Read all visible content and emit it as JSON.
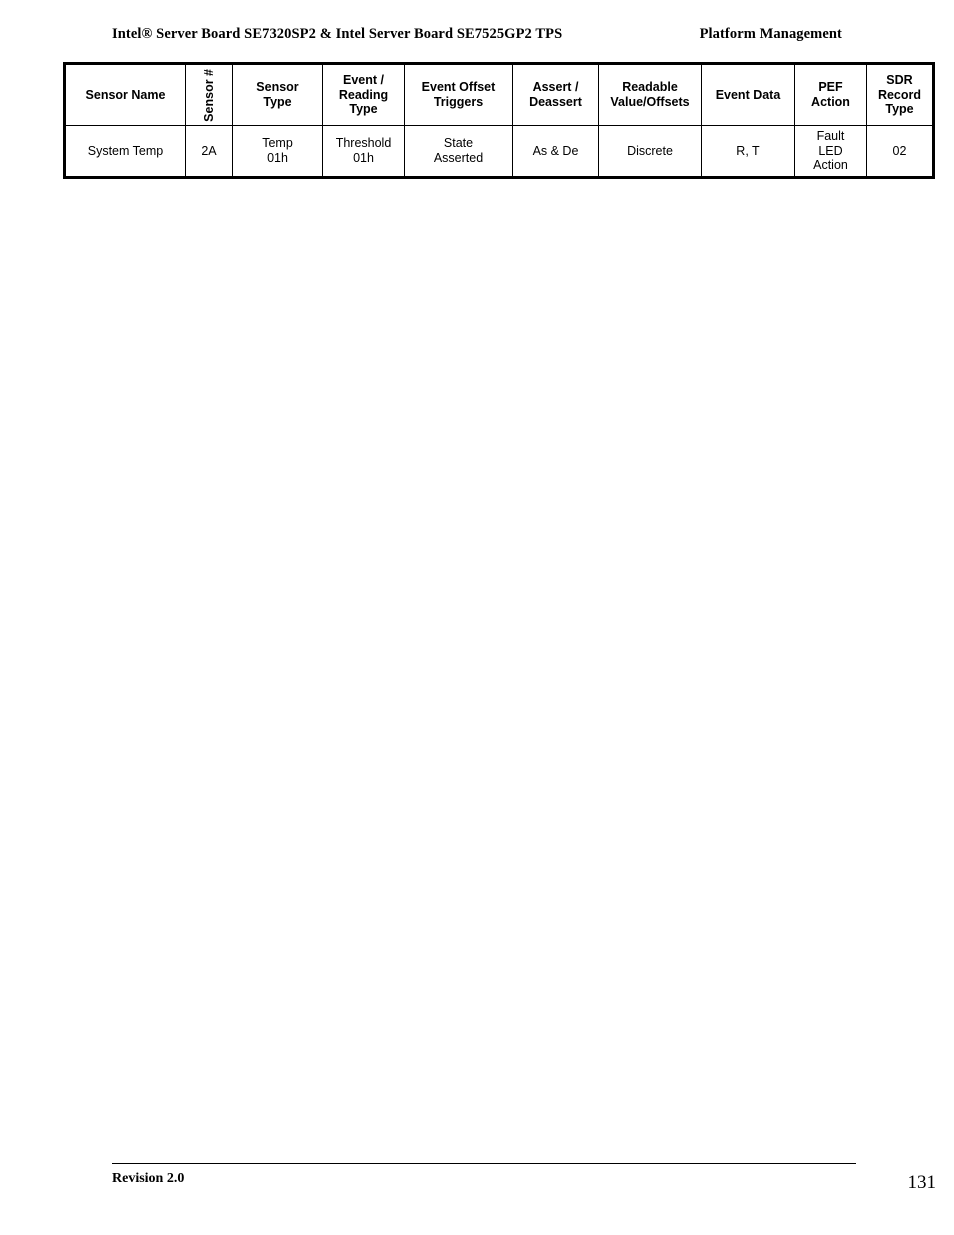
{
  "header": {
    "left_title": "Intel® Server Board SE7320SP2 & Intel Server Board SE7525GP2 TPS",
    "right_title": "Platform Management"
  },
  "table": {
    "columns": [
      {
        "label": "Sensor Name",
        "orientation": "horizontal"
      },
      {
        "label": "Sensor #",
        "orientation": "vertical"
      },
      {
        "label_line1": "Sensor",
        "label_line2": "Type",
        "orientation": "horizontal"
      },
      {
        "label_line1": "Event /",
        "label_line2": "Reading",
        "label_line3": "Type",
        "orientation": "horizontal"
      },
      {
        "label_line1": "Event Offset",
        "label_line2": "Triggers",
        "orientation": "horizontal"
      },
      {
        "label_line1": "Assert /",
        "label_line2": "Deassert",
        "orientation": "horizontal"
      },
      {
        "label_line1": "Readable",
        "label_line2": "Value/Offsets",
        "orientation": "horizontal"
      },
      {
        "label": "Event Data",
        "orientation": "horizontal"
      },
      {
        "label_line1": "PEF",
        "label_line2": "Action",
        "orientation": "horizontal"
      },
      {
        "label_line1": "SDR",
        "label_line2": "Record",
        "label_line3": "Type",
        "orientation": "horizontal"
      }
    ],
    "rows": [
      {
        "sensor_name": "System Temp",
        "sensor_number": "2A",
        "sensor_type_line1": "Temp",
        "sensor_type_line2": "01h",
        "event_reading_type_line1": "Threshold",
        "event_reading_type_line2": "01h",
        "event_offset_triggers_line1": "State",
        "event_offset_triggers_line2": "Asserted",
        "assert_deassert": "As & De",
        "readable_value_offsets": "Discrete",
        "event_data": "R, T",
        "pef_action_line1": "Fault",
        "pef_action_line2": "LED",
        "pef_action_line3": "Action",
        "sdr_record_type": "02"
      }
    ]
  },
  "footer": {
    "revision": "Revision 2.0",
    "page_number": "131"
  }
}
